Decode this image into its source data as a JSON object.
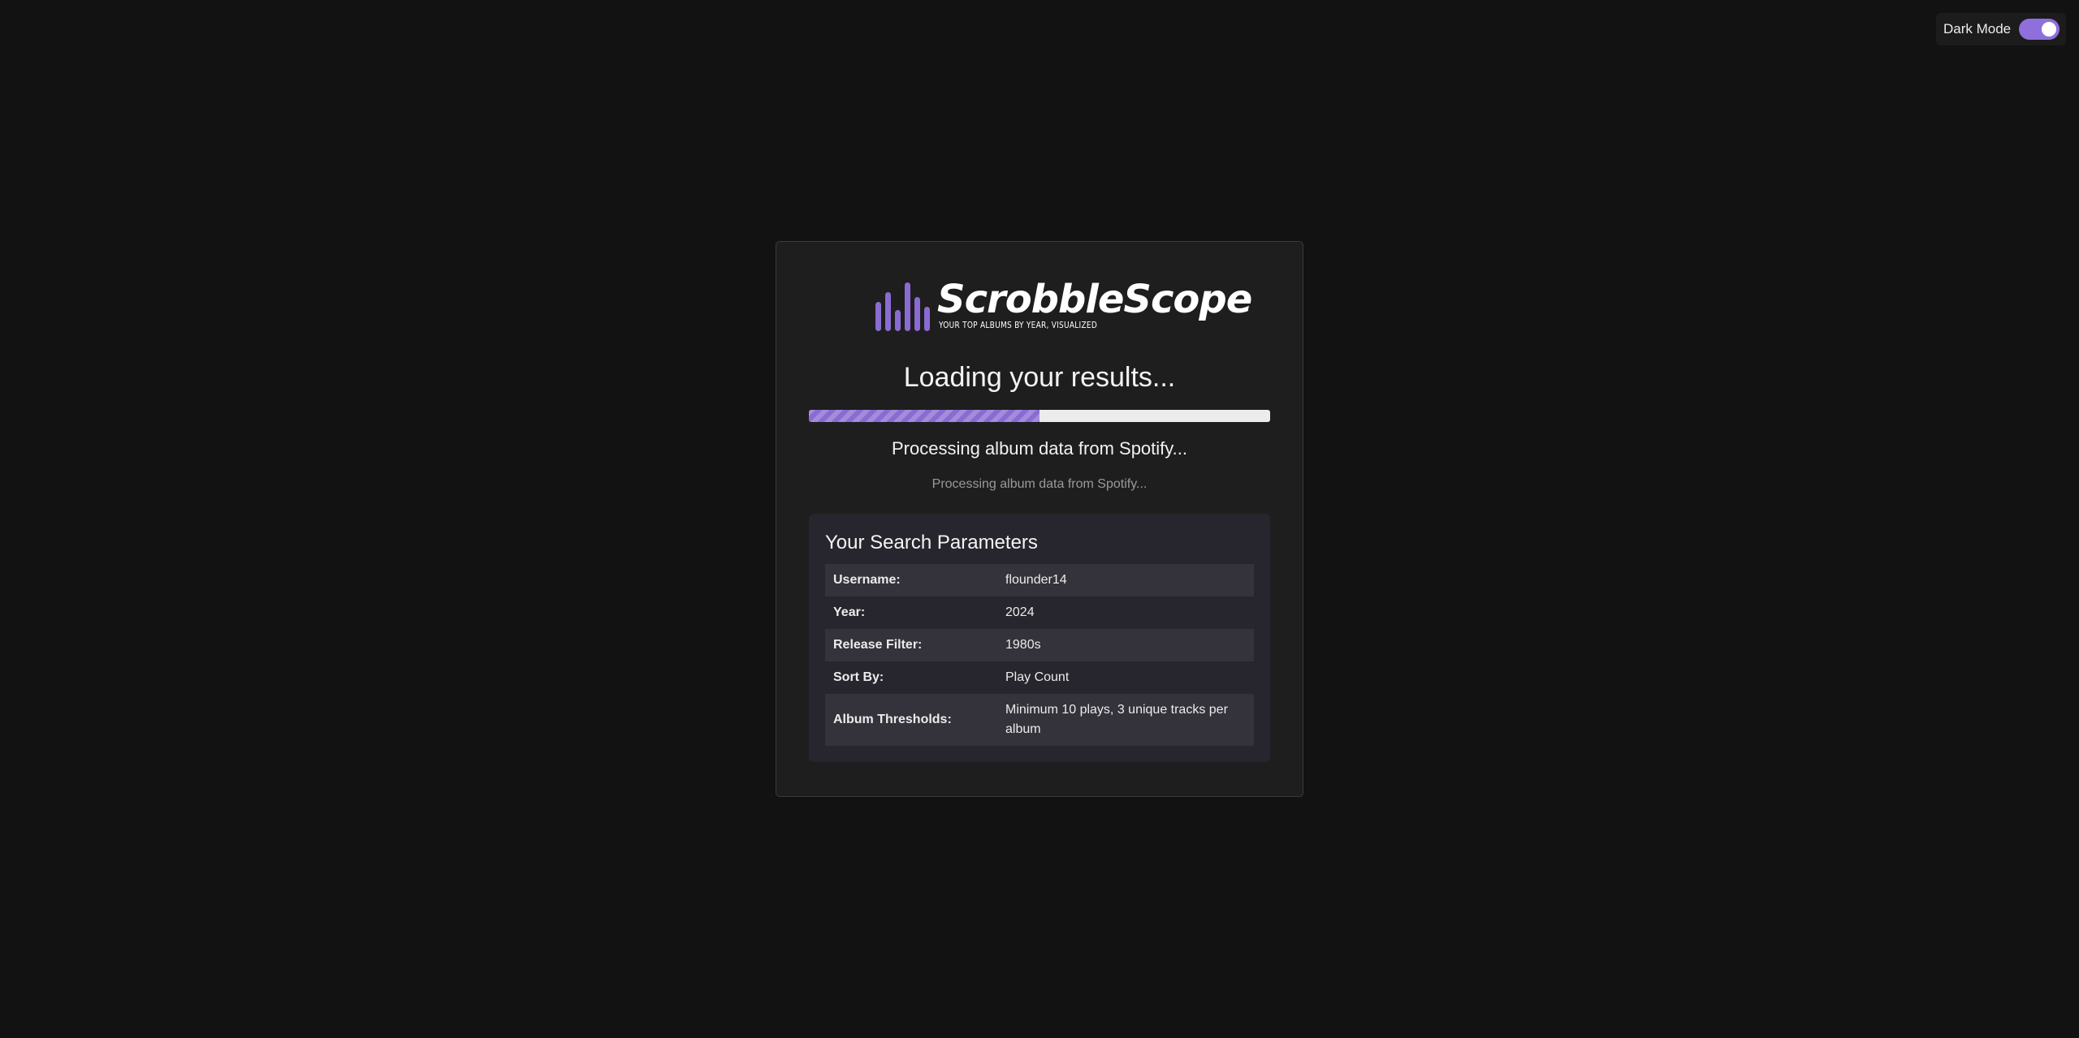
{
  "theme_toggle": {
    "label": "Dark Mode",
    "enabled": true
  },
  "logo": {
    "name": "ScrobbleScope",
    "tagline": "YOUR TOP ALBUMS BY YEAR, VISUALIZED"
  },
  "loading": {
    "title": "Loading your results...",
    "progress_fraction": 0.5,
    "status": "Processing album data from Spotify...",
    "substatus": "Processing album data from Spotify..."
  },
  "params": {
    "title": "Your Search Parameters",
    "rows": [
      {
        "key": "Username:",
        "value": "flounder14"
      },
      {
        "key": "Year:",
        "value": "2024"
      },
      {
        "key": "Release Filter:",
        "value": "1980s"
      },
      {
        "key": "Sort By:",
        "value": "Play Count"
      },
      {
        "key": "Album Thresholds:",
        "value": "Minimum 10 plays, 3 unique tracks per album"
      }
    ]
  },
  "colors": {
    "background": "#121212",
    "card": "#1e1e1e",
    "accent": "#8a6bd2",
    "panel": "#27252d"
  }
}
